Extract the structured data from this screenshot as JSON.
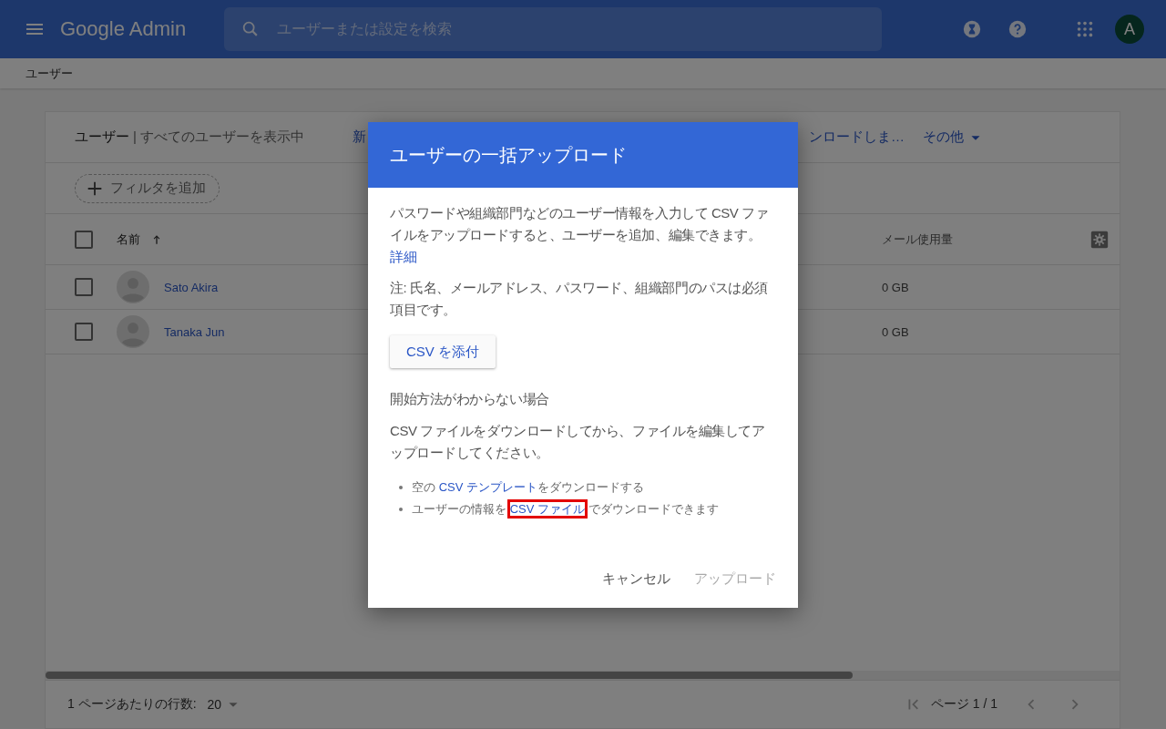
{
  "app_bar": {
    "logo": "Google Admin",
    "search": {
      "placeholder": "ユーザーまたは設定を検索"
    },
    "avatar": "A"
  },
  "breadcrumb": "ユーザー",
  "users_panel": {
    "title": "ユーザー",
    "subtitle": "| すべてのユーザーを表示中",
    "actions": [
      "新",
      "ンロードしま…"
    ],
    "more_menu": "その他",
    "filter_button": "フィルタを追加",
    "select_all_checked": false,
    "columns": [
      {
        "label": "名前",
        "sorted": true
      },
      {
        "label": "メール使用量",
        "sorted": false
      }
    ],
    "rows": [
      {
        "name": "Sato Akira",
        "mail_usage": "0 GB",
        "checked": false
      },
      {
        "name": "Tanaka Jun",
        "mail_usage": "0 GB",
        "checked": false
      }
    ],
    "footer": {
      "rows_per_page_label": "1 ページあたりの行数:",
      "rows_per_page": "20",
      "page": "ページ 1 / 1"
    }
  },
  "dialog": {
    "title": "ユーザーの一括アップロード",
    "intro": "パスワードや組織部門などのユーザー情報を入力して CSV ファイルをアップロードすると、ユーザーを追加、編集できます。",
    "details_link": "詳細",
    "note": "注: 氏名、メールアドレス、パスワード、組織部門のパスは必須項目です。",
    "attach_button": "CSV を添付",
    "help_heading": "開始方法がわからない場合",
    "help_text": "CSV ファイルをダウンロードしてから、ファイルを編集してアップロードしてください。",
    "bullets": [
      [
        {
          "kind": "text",
          "text": "空の "
        },
        {
          "kind": "link",
          "text": "CSV テンプレート",
          "highlighted": false
        },
        {
          "kind": "text",
          "text": "をダウンロードする"
        }
      ],
      [
        {
          "kind": "text",
          "text": "ユーザーの情報を "
        },
        {
          "kind": "link",
          "text": "CSV ファイル",
          "highlighted": true
        },
        {
          "kind": "text",
          "text": " でダウンロードできます"
        }
      ]
    ],
    "buttons": [
      {
        "label": "キャンセル",
        "disabled": false
      },
      {
        "label": "アップロード",
        "disabled": true
      }
    ]
  }
}
